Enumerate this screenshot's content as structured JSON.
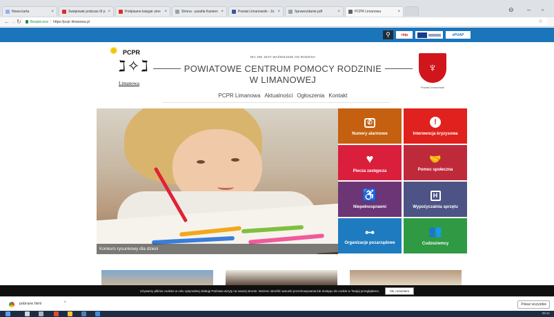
{
  "browser": {
    "tabs": [
      {
        "label": "Nowa karta",
        "color": "#8ab4f8"
      },
      {
        "label": "Świątowak podczas III p",
        "color": "#d93025"
      },
      {
        "label": "Podpisane księgie umo",
        "color": "#d93025"
      },
      {
        "label": "Strona - parafia Kamien",
        "color": "#9aa0a6"
      },
      {
        "label": "Powiat Limanowski - Zs",
        "color": "#3b5998"
      },
      {
        "label": "Sprawozdanie.pdf",
        "color": "#9aa0a6"
      },
      {
        "label": "PCPR Limanowa",
        "color": "#5f6368"
      }
    ],
    "address": {
      "secure_label": "Bezpieczna",
      "url": "https://pcpr-limanowa.pl"
    }
  },
  "header": {
    "partners": [
      {
        "label": "+bip",
        "color": "#d0161c"
      },
      {
        "label": "EU",
        "color": "#1b3c8c"
      },
      {
        "label": "ePUAP",
        "color": "#1b75bb"
      }
    ],
    "logo": {
      "acronym": "PCPR",
      "town": "Limanowa"
    },
    "motto": "NIC NIE JEST WAŻNIEJSZE OD RODZINY",
    "title_line1": "POWIATOWE CENTRUM POMOCY RODZINIE",
    "title_line2": "W LIMANOWEJ",
    "crest_label": "Powiat Limanowski"
  },
  "menu": [
    "PCPR Limanowa",
    "Aktualności",
    "Ogłoszenia",
    "Kontakt"
  ],
  "hero": {
    "caption": "Konkurs rysunkowy dla dzieci"
  },
  "tiles": [
    {
      "label": "Numery alarmowe",
      "color": "#c4600f",
      "icon": "phone-icon"
    },
    {
      "label": "Interwencja kryzysowa",
      "color": "#e0211d",
      "icon": "exclamation-icon"
    },
    {
      "label": "Piecza zastępcza",
      "color": "#da1f3d",
      "icon": "heart-icon"
    },
    {
      "label": "Pomoc społeczna",
      "color": "#bf2a3b",
      "icon": "handshake-icon"
    },
    {
      "label": "Niepełnosprawni",
      "color": "#6b3576",
      "icon": "wheelchair-icon"
    },
    {
      "label": "Wypożyczalnia sprzętu",
      "color": "#4d5384",
      "icon": "floppy-icon"
    },
    {
      "label": "Organizacje pozarządowe",
      "color": "#1f7bbf",
      "icon": "hierarchy-icon"
    },
    {
      "label": "Cudzoziemcy",
      "color": "#2f9a43",
      "icon": "group-icon"
    }
  ],
  "cookie": {
    "text": "Używamy plików cookies w celu optymalnej obsługi Państwa wizyty na naszej stronie. Możesz określić warunki przechowywania lub dostępu do cookie w Twojej przeglądarce.",
    "button": "Ok, rozumiem"
  },
  "downloads": {
    "file": "pobrane.html",
    "show_all": "Pokaż wszystkie"
  },
  "taskbar": {
    "time": "09:41"
  }
}
